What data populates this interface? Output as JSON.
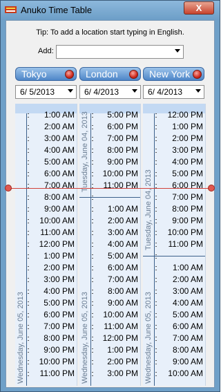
{
  "window": {
    "title": "Anuko Time Table",
    "close_label": "X"
  },
  "tip": "Tip: To add a location start typing in English.",
  "add": {
    "label": "Add:",
    "value": ""
  },
  "cities": [
    {
      "name": "Tokyo",
      "date": "6/  5/2013"
    },
    {
      "name": "London",
      "date": "6/  4/2013"
    },
    {
      "name": "New York",
      "date": "6/  4/2013"
    }
  ],
  "columns": [
    {
      "times": [
        "1:00 AM",
        "2:00 AM",
        "3:00 AM",
        "4:00 AM",
        "5:00 AM",
        "6:00 AM",
        "7:00 AM",
        "8:00 AM",
        "9:00 AM",
        "10:00 AM",
        "11:00 AM",
        "12:00 PM",
        "1:00 PM",
        "2:00 PM",
        "3:00 PM",
        "4:00 PM",
        "5:00 PM",
        "6:00 PM",
        "7:00 PM",
        "8:00 PM",
        "9:00 PM",
        "10:00 PM",
        "11:00 PM"
      ],
      "day_labels": [
        "Wednesday, June 05, 2013"
      ]
    },
    {
      "times": [
        "5:00 PM",
        "6:00 PM",
        "7:00 PM",
        "8:00 PM",
        "9:00 PM",
        "10:00 PM",
        "11:00 PM",
        "",
        "1:00 AM",
        "2:00 AM",
        "3:00 AM",
        "4:00 AM",
        "5:00 AM",
        "6:00 AM",
        "7:00 AM",
        "8:00 AM",
        "9:00 AM",
        "10:00 AM",
        "11:00 AM",
        "12:00 PM",
        "1:00 PM",
        "2:00 PM",
        "3:00 PM"
      ],
      "day_labels": [
        "Tuesday, June 04, 2013",
        "Wednesday, June 05, 2013"
      ]
    },
    {
      "times": [
        "12:00 PM",
        "1:00 PM",
        "2:00 PM",
        "3:00 PM",
        "4:00 PM",
        "5:00 PM",
        "6:00 PM",
        "7:00 PM",
        "8:00 PM",
        "9:00 PM",
        "10:00 PM",
        "11:00 PM",
        "",
        "1:00 AM",
        "2:00 AM",
        "3:00 AM",
        "4:00 AM",
        "5:00 AM",
        "6:00 AM",
        "7:00 AM",
        "8:00 AM",
        "9:00 AM",
        "10:00 AM"
      ],
      "day_labels": [
        "Tuesday, June 04, 2013",
        "Wednesday, June 05, 2013"
      ]
    }
  ]
}
